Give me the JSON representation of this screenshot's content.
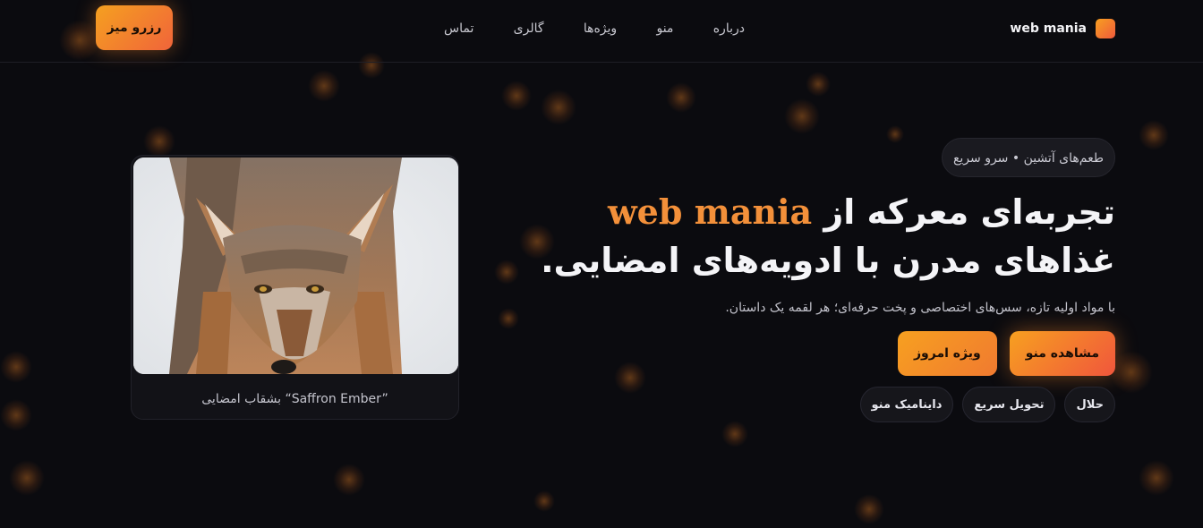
{
  "header": {
    "brand_name": "web mania",
    "nav": [
      "درباره",
      "منو",
      "ویژه‌ها",
      "گالری",
      "تماس"
    ],
    "reserve_label": "رزرو میز"
  },
  "hero": {
    "pill_text": "طعم‌های آتشین • سرو سریع",
    "title_accent": "web mania",
    "title_line1": "تجربه‌ای معرکه از",
    "title_line2": "غذاهای مدرن با ادویه‌های امضایی.",
    "subtitle": "با مواد اولیه تازه، سس‌های اختصاصی و پخت حرفه‌ای؛ هر لقمه یک داستان.",
    "cta_primary": "مشاهده منو",
    "cta_secondary": "ویژه امروز",
    "tags": [
      "حلال",
      "تحویل سریع",
      "داینامیک منو"
    ]
  },
  "card": {
    "caption": "بشقاب امضایی “Saffron Ember”"
  },
  "colors": {
    "accent": "#f3903a",
    "gradient_start": "#f7a020",
    "gradient_end": "#f0563c",
    "background": "#0b0b0f"
  }
}
